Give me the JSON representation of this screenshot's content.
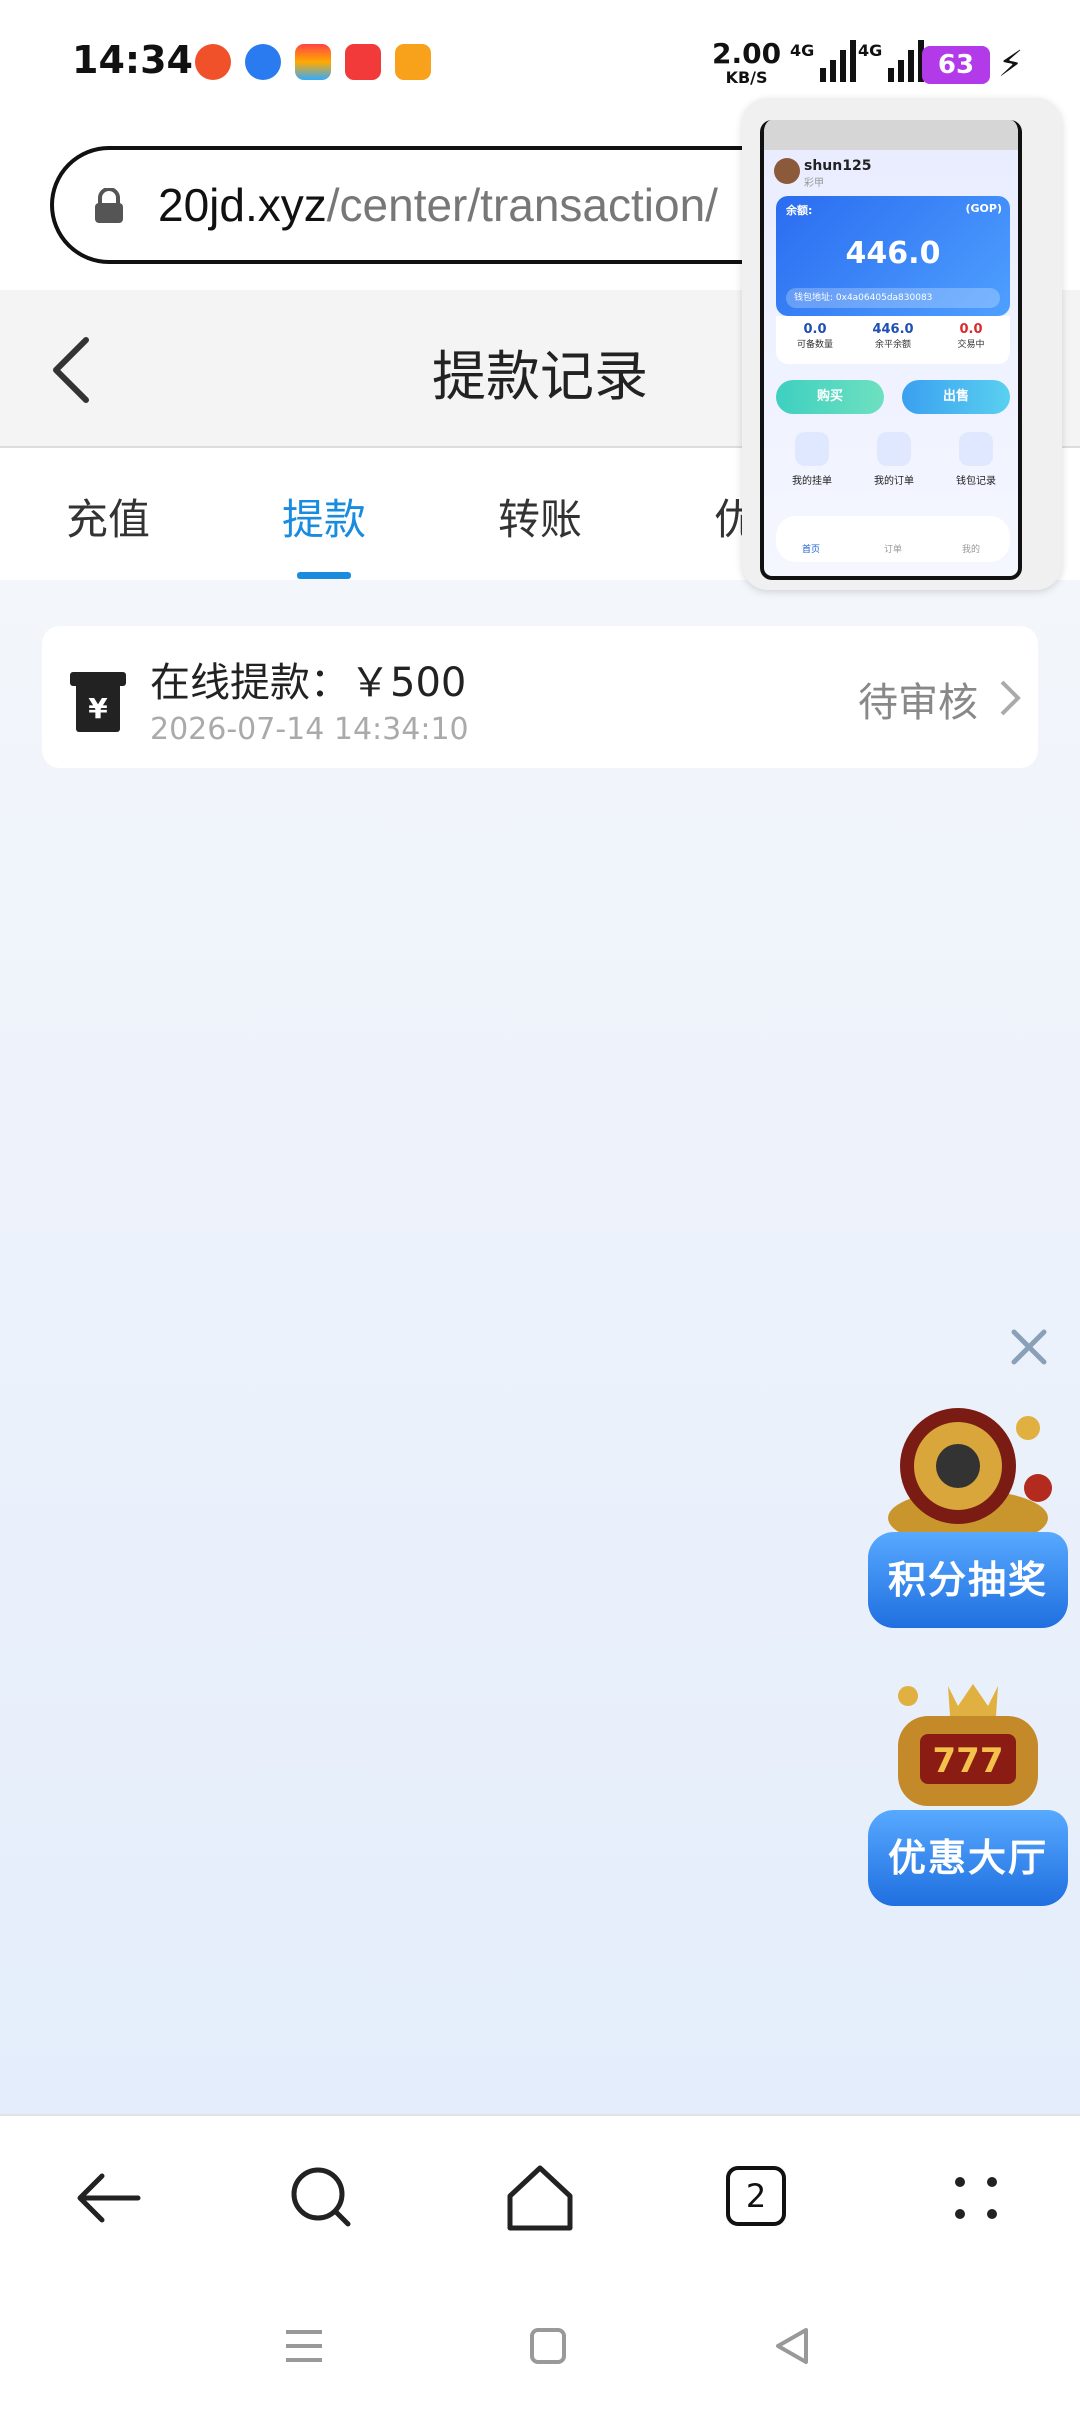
{
  "status_bar": {
    "time": "14:34",
    "net_speed_value": "2.00",
    "net_speed_unit": "KB/S",
    "battery": "63",
    "signal_1": "4G",
    "signal_2": "4G"
  },
  "url_bar": {
    "domain": "20jd.xyz",
    "path": "/center/transaction/"
  },
  "header": {
    "title": "提款记录"
  },
  "tabs": [
    {
      "label": "充值",
      "active": false
    },
    {
      "label": "提款",
      "active": true
    },
    {
      "label": "转账",
      "active": false
    },
    {
      "label": "优",
      "active": false
    }
  ],
  "records": [
    {
      "title": "在线提款：￥500",
      "time": "2026-07-14 14:34:10",
      "status": "待审核"
    }
  ],
  "promos": [
    {
      "label": "积分抽奖"
    },
    {
      "label": "优惠大厅"
    }
  ],
  "mini_preview": {
    "username": "shun125",
    "sub": "彩甲",
    "balance_label": "余额:",
    "currency": "(GOP)",
    "balance": "446.0",
    "address": "钱包地址: 0x4a06405da830083",
    "stats": [
      {
        "value": "0.0",
        "label": "可备数量"
      },
      {
        "value": "446.0",
        "label": "余平余额"
      },
      {
        "value": "0.0",
        "label": "交易中"
      }
    ],
    "buy": "购买",
    "sell": "出售",
    "menu": [
      "我的挂单",
      "我的订单",
      "钱包记录"
    ],
    "nav": [
      "首页",
      "订单",
      "我的"
    ]
  },
  "browser": {
    "tab_count": "2"
  },
  "colors": {
    "accent": "#1a8ce0",
    "battery": "#b33ae8"
  }
}
